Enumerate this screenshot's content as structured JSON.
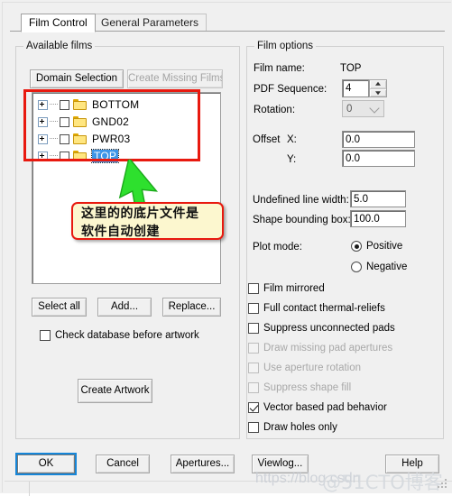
{
  "window": {
    "tabs": [
      {
        "label": "Film Control",
        "active": true
      },
      {
        "label": "General Parameters",
        "active": false
      }
    ]
  },
  "available_films": {
    "title": "Available films",
    "buttons": {
      "domain_selection": "Domain Selection",
      "create_missing_films": "Create Missing Films",
      "select_all": "Select all",
      "add": "Add...",
      "replace": "Replace...",
      "create_artwork": "Create Artwork"
    },
    "tree_items": [
      {
        "label": "BOTTOM",
        "checked": false,
        "selected": false
      },
      {
        "label": "GND02",
        "checked": false,
        "selected": false
      },
      {
        "label": "PWR03",
        "checked": false,
        "selected": false
      },
      {
        "label": "TOP",
        "checked": false,
        "selected": true
      }
    ],
    "check_database": {
      "label": "Check database before artwork",
      "checked": false
    }
  },
  "film_options": {
    "title": "Film options",
    "film_name": {
      "label": "Film name:",
      "value": "TOP"
    },
    "pdf_sequence": {
      "label": "PDF Sequence:",
      "value": "4"
    },
    "rotation": {
      "label": "Rotation:",
      "value": "0",
      "disabled": true
    },
    "offset": {
      "label": "Offset",
      "x_label": "X:",
      "x_value": "0.0",
      "y_label": "Y:",
      "y_value": "0.0"
    },
    "undefined_line_width": {
      "label": "Undefined line width:",
      "value": "5.0"
    },
    "shape_bounding_box": {
      "label": "Shape bounding box:",
      "value": "100.0"
    },
    "plot_mode": {
      "label": "Plot mode:",
      "options": [
        {
          "label": "Positive",
          "selected": true
        },
        {
          "label": "Negative",
          "selected": false
        }
      ]
    },
    "checkboxes": [
      {
        "label": "Film mirrored",
        "checked": false,
        "disabled": false
      },
      {
        "label": "Full contact thermal-reliefs",
        "checked": false,
        "disabled": false
      },
      {
        "label": "Suppress unconnected pads",
        "checked": false,
        "disabled": false
      },
      {
        "label": "Draw missing pad apertures",
        "checked": false,
        "disabled": true
      },
      {
        "label": "Use aperture rotation",
        "checked": false,
        "disabled": true
      },
      {
        "label": "Suppress shape fill",
        "checked": false,
        "disabled": true
      },
      {
        "label": "Vector based pad behavior",
        "checked": true,
        "disabled": false
      },
      {
        "label": "Draw holes only",
        "checked": false,
        "disabled": false
      }
    ]
  },
  "footer": {
    "ok": "OK",
    "cancel": "Cancel",
    "apertures": "Apertures...",
    "viewlog": "Viewlog...",
    "help": "Help"
  },
  "annotations": {
    "callout_line1": "这里的的底片文件是",
    "callout_line2": "软件自动创建",
    "highlight_color": "#e8190f",
    "callout_bg": "#fcf7cf",
    "cursor_color": "#2ee02e"
  },
  "watermark": {
    "text_a": "https://blog.csdn",
    "text_b": "@51CTO博客"
  }
}
